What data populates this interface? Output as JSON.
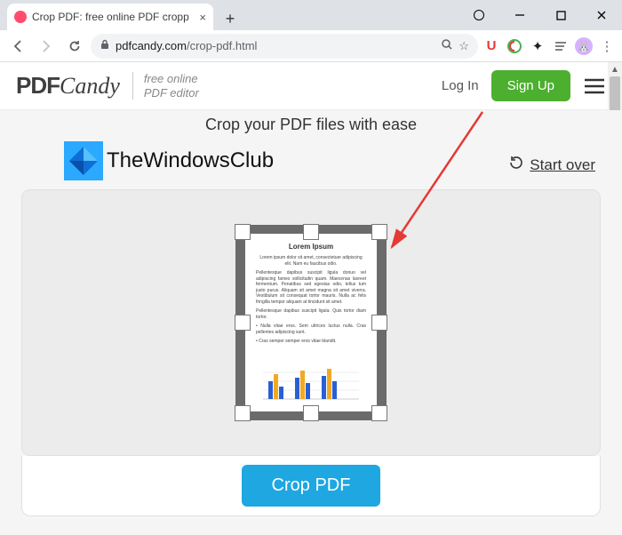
{
  "browser": {
    "tab_title": "Crop PDF: free online PDF cropp",
    "url_host": "pdfcandy.com",
    "url_path": "/crop-pdf.html",
    "ext_u": "U"
  },
  "header": {
    "logo_pdf": "PDF",
    "logo_candy": "Candy",
    "tagline_l1": "free online",
    "tagline_l2": "PDF editor",
    "login": "Log In",
    "signup": "Sign Up"
  },
  "main": {
    "headline": "Crop your PDF files with ease",
    "watermark": "TheWindowsClub",
    "start_over": "Start over",
    "crop_button": "Crop PDF",
    "doc_title": "Lorem Ipsum",
    "doc_sub": "Lorem ipsum dolor sit amet, consectetuer adipiscing elit. Nam eu faucibus odio.",
    "doc_p1": "Pellentesque dapibus suscipit ligula donuo vel adipiscing fames sollicitudin quam. Maecenas laoreet fermentum. Penatibus sed egestas odio, tellus tum justo purus. Aliquam sit amet magna sit amet viverra. Vestibulum sit consequat tortor mauris. Nulla ac felis fringilla tempor aliquam at tincidunt sit amet.",
    "doc_p2": "Pellentesque dapibus suscipit ligula. Quis tortor diam tortor.",
    "doc_b1": "Nulla vitae eros. Sem ultrices luctus nulla. Cras pellentes adipiscing sunt.",
    "doc_b2": "Cras semper semper eros vitae blandit."
  }
}
